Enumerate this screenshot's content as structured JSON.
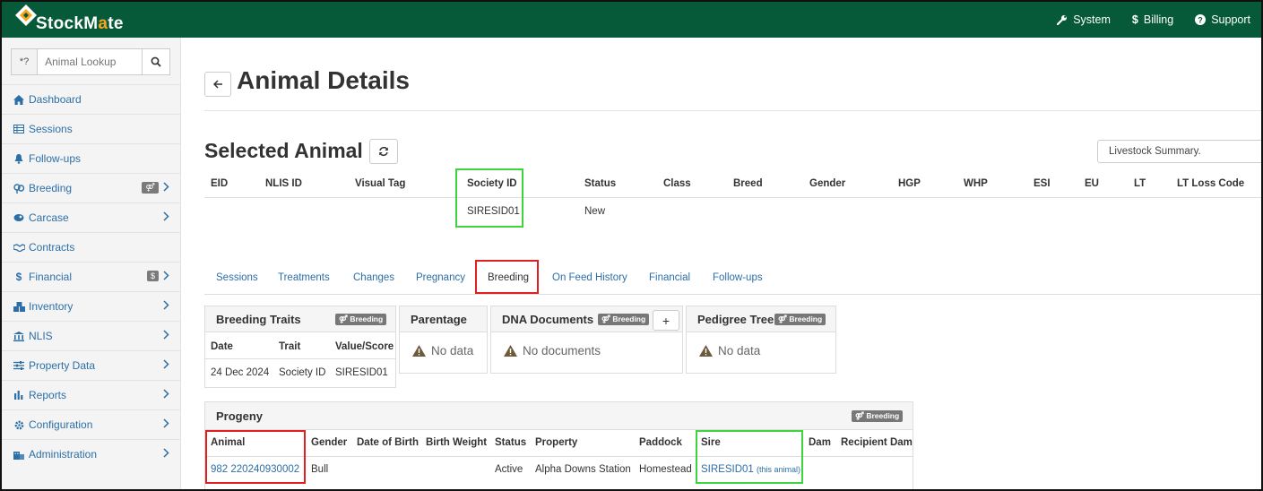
{
  "app": {
    "name": "StockMate",
    "name_a": "StockM",
    "name_b": "a",
    "name_c": "te"
  },
  "topnav": {
    "system": "System",
    "billing": "Billing",
    "support": "Support"
  },
  "lookup": {
    "prefix": "*?",
    "placeholder": "Animal Lookup"
  },
  "sidebar": {
    "items": [
      {
        "label": "Dashboard",
        "icon": "home-icon"
      },
      {
        "label": "Sessions",
        "icon": "table-icon"
      },
      {
        "label": "Follow-ups",
        "icon": "bell-icon"
      },
      {
        "label": "Breeding",
        "icon": "gender-icon",
        "badge": "⚤"
      },
      {
        "label": "Carcase",
        "icon": "carcase-icon"
      },
      {
        "label": "Contracts",
        "icon": "handshake-icon"
      },
      {
        "label": "Financial",
        "icon": "dollar-icon",
        "badge": "$"
      },
      {
        "label": "Inventory",
        "icon": "inventory-icon"
      },
      {
        "label": "NLIS",
        "icon": "bank-icon"
      },
      {
        "label": "Property Data",
        "icon": "sliders-icon"
      },
      {
        "label": "Reports",
        "icon": "bar-chart-icon"
      },
      {
        "label": "Configuration",
        "icon": "cog-icon"
      },
      {
        "label": "Administration",
        "icon": "building-icon"
      }
    ]
  },
  "page": {
    "title": "Animal Details",
    "selected_title": "Selected Animal",
    "summary_select": "Livestock Summary."
  },
  "animal_table": {
    "headers": [
      "EID",
      "NLIS ID",
      "Visual Tag",
      "Society ID",
      "Status",
      "Class",
      "Breed",
      "Gender",
      "HGP",
      "WHP",
      "ESI",
      "EU",
      "LT",
      "LT Loss Code"
    ],
    "row": {
      "society_id": "SIRESID01",
      "status": "New"
    }
  },
  "tabs": [
    "Sessions",
    "Treatments",
    "Changes",
    "Pregnancy",
    "Breeding",
    "On Feed History",
    "Financial",
    "Follow-ups"
  ],
  "active_tab": "Breeding",
  "cards": {
    "breeding_traits": {
      "title": "Breeding Traits",
      "tag": "⚤ Breeding",
      "headers": [
        "Date",
        "Trait",
        "Value/Score"
      ],
      "row": [
        "24 Dec 2024",
        "Society ID",
        "SIRESID01"
      ]
    },
    "parentage": {
      "title": "Parentage",
      "empty": "No data"
    },
    "dna": {
      "title": "DNA Documents",
      "tag": "⚤ Breeding",
      "add": "+",
      "empty": "No documents"
    },
    "pedigree": {
      "title": "Pedigree Tree",
      "tag": "⚤ Breeding",
      "empty": "No data"
    },
    "progeny": {
      "title": "Progeny",
      "tag": "⚤ Breeding",
      "headers": [
        "Animal",
        "Gender",
        "Date of Birth",
        "Birth Weight",
        "Status",
        "Property",
        "Paddock",
        "Sire",
        "Dam",
        "Recipient Dam"
      ],
      "row": {
        "animal": "982 220240930002",
        "gender": "Bull",
        "status": "Active",
        "property": "Alpha Downs Station",
        "paddock": "Homestead",
        "sire": "SIRESID01",
        "sire_note": "(this animal)"
      }
    }
  },
  "colors": {
    "topbar": "#065a39",
    "link": "#2c6fa8",
    "highlight_green": "#3ed43e",
    "highlight_red": "#e02020",
    "logo_accent": "#f7a51c"
  }
}
